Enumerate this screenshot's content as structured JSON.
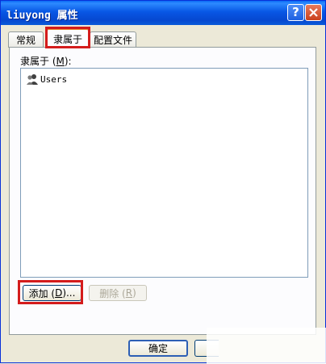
{
  "window": {
    "title": "liuyong 属性"
  },
  "titlebar_buttons": {
    "help_glyph": "?",
    "close_icon": "close-icon"
  },
  "tabs": [
    {
      "label": "常规",
      "selected": false
    },
    {
      "label": "隶属于",
      "selected": true
    },
    {
      "label": "配置文件",
      "selected": false
    }
  ],
  "memberof": {
    "label_prefix": "隶属于 (",
    "label_key": "M",
    "label_suffix": "):",
    "items": [
      {
        "name": "Users",
        "icon": "group-icon"
      }
    ]
  },
  "buttons": {
    "add_prefix": "添加 (",
    "add_key": "D",
    "add_suffix": ")...",
    "remove_prefix": "删除 (",
    "remove_key": "R",
    "remove_suffix": ")",
    "ok": "确定"
  },
  "colors": {
    "highlight": "#d41c1c",
    "titlebar": "#0857e5",
    "tab_accent": "#e68b2c"
  }
}
